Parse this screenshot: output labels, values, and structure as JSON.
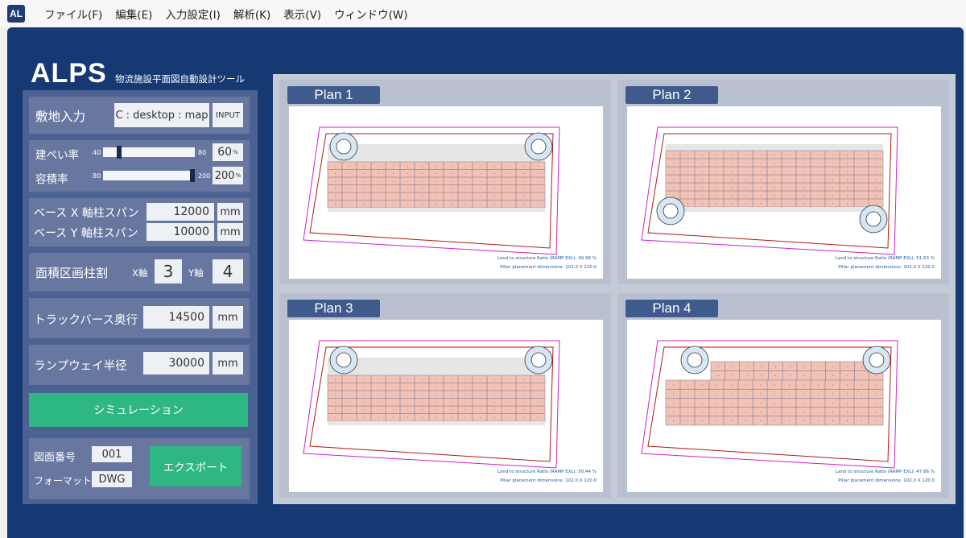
{
  "app": {
    "icon_text": "AL",
    "logo": "ALPS",
    "subtitle": "物流施設平面図自動設計ツール"
  },
  "menu": [
    "ファイル(F)",
    "編集(E)",
    "入力設定(I)",
    "解析(K)",
    "表示(V)",
    "ウィンドウ(W)"
  ],
  "site": {
    "label": "敷地入力",
    "path": "C : desktop : map",
    "button": "INPUT"
  },
  "coverage": {
    "label": "建ぺい率",
    "min": "40",
    "max": "80",
    "value": "60",
    "unit": "%",
    "fraction": 0.6
  },
  "floor_ratio": {
    "label": "容積率",
    "min": "80",
    "max": "200",
    "value": "200",
    "unit": "%",
    "fraction": 1.0
  },
  "span_x": {
    "label": "ベース X 軸柱スパン",
    "value": "12000",
    "unit": "mm"
  },
  "span_y": {
    "label": "ベース Y 軸柱スパン",
    "value": "10000",
    "unit": "mm"
  },
  "pillar_div": {
    "label": "面積区画柱割",
    "x_label": "X軸",
    "x_value": "3",
    "y_label": "Y軸",
    "y_value": "4"
  },
  "truck_berth": {
    "label": "トラックバース奥行",
    "value": "14500",
    "unit": "mm"
  },
  "ramp": {
    "label": "ランプウェイ半径",
    "value": "30000",
    "unit": "mm"
  },
  "simulate_button": "シミュレーション",
  "drawing_no": {
    "label": "図面番号",
    "value": "001"
  },
  "format": {
    "label": "フォーマット",
    "value": "DWG"
  },
  "export_button": "エクスポート",
  "plans": [
    {
      "name": "Plan 1",
      "ratio": "Land to structure Ratio (RAMP EXL): 49.98 %",
      "dims": "Pillar placement dimensions: 102.0 X 120.0",
      "ramps": "top"
    },
    {
      "name": "Plan 2",
      "ratio": "Land to structure Ratio (RAMP EXL): 51.63 %",
      "dims": "Pillar placement dimensions: 102.0 X 120.0",
      "ramps": "bottom"
    },
    {
      "name": "Plan 3",
      "ratio": "Land to structure Ratio (RAMP EXL): 50.44 %",
      "dims": "Pillar placement dimensions: 102.0 X 120.0",
      "ramps": "top"
    },
    {
      "name": "Plan 4",
      "ratio": "Land to structure Ratio (RAMP EXL): 47.66 %",
      "dims": "Pillar placement dimensions: 102.0 X 120.0",
      "ramps": "top-stepped"
    }
  ],
  "colors": {
    "navy": "#163873",
    "panel": "#4a6191",
    "group": "#67779f",
    "accent_green": "#2fb783",
    "structure_fill": "#f2c2b4",
    "site_outline": "#cc22cc",
    "setback_outline": "#b31a1a",
    "ramp_fill": "#d6e6f3"
  }
}
